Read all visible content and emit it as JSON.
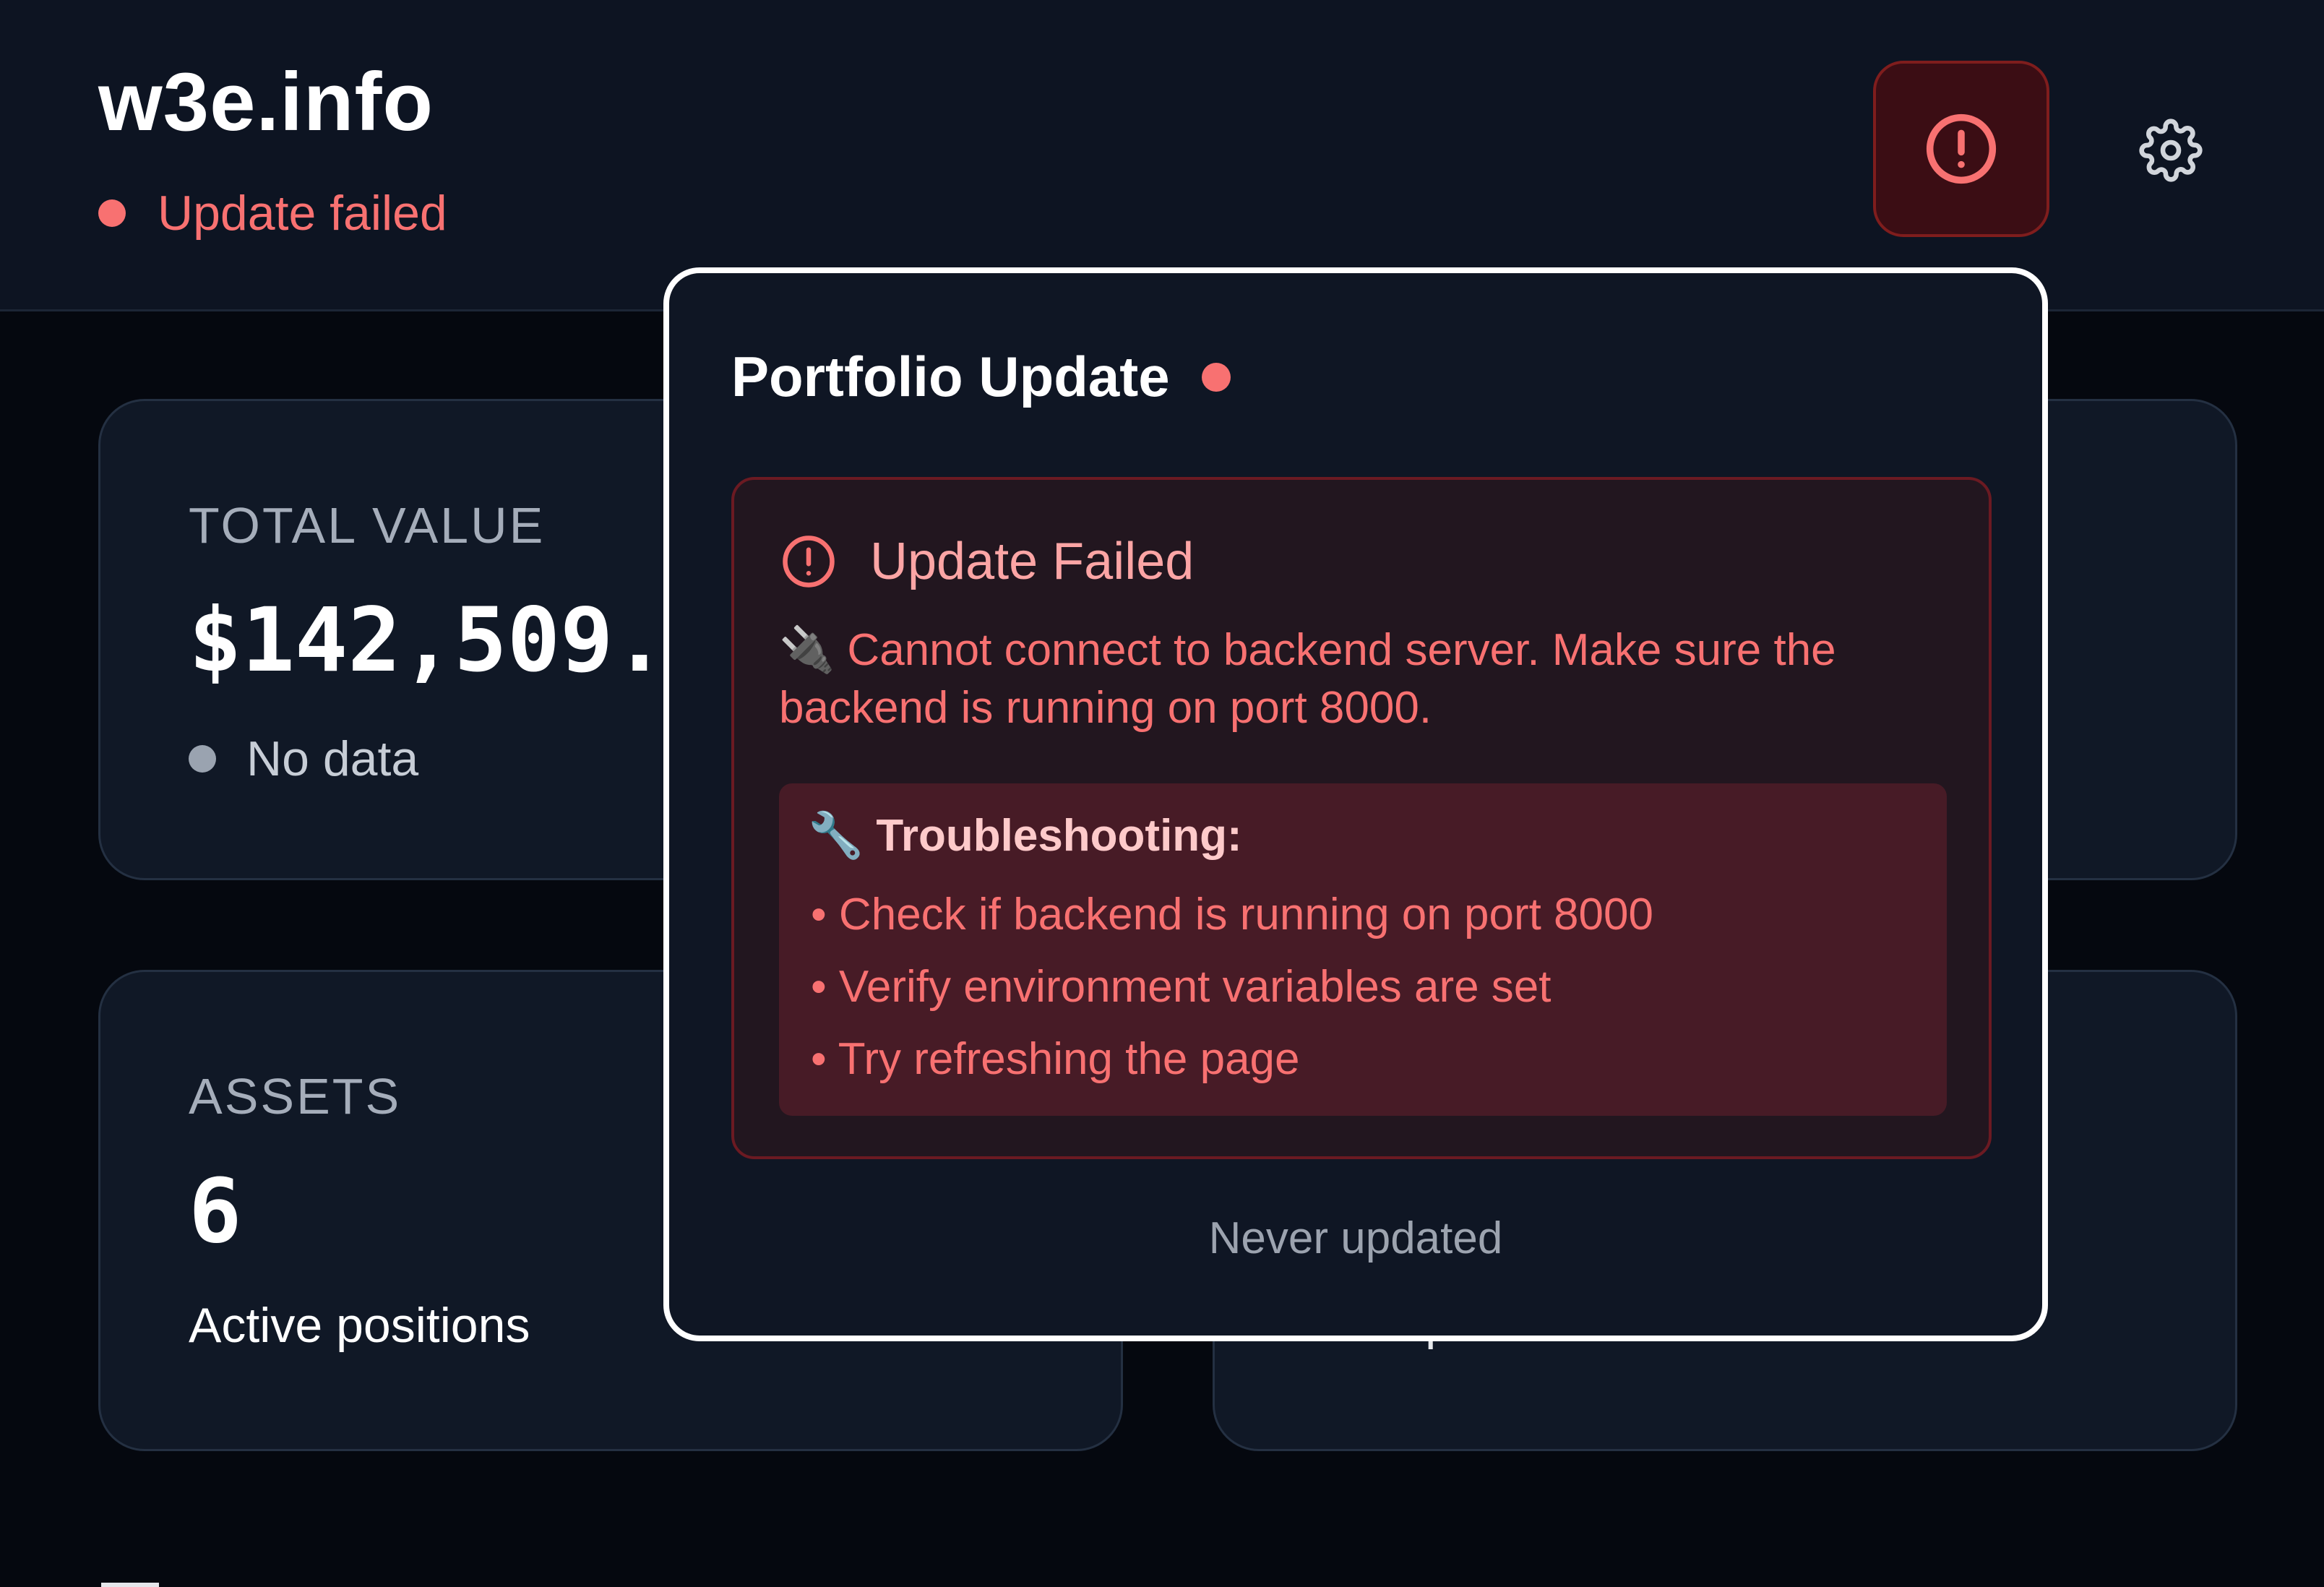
{
  "header": {
    "brand": "w3e.info",
    "status_text": "Update failed",
    "status_color": "#f87171",
    "alert_icon": "alert-circle-icon",
    "settings_icon": "gear-icon"
  },
  "cards": {
    "total_value": {
      "label": "TOTAL VALUE",
      "value": "$142,509.",
      "sub": "No data"
    },
    "assets": {
      "label": "ASSETS",
      "value": "6",
      "sub": "Active positions"
    },
    "right_bottom": {
      "sub_partial": "... of portfolio"
    }
  },
  "popup": {
    "title": "Portfolio Update",
    "error": {
      "title": "Update Failed",
      "icon": "alert-circle-icon",
      "message": "🔌 Cannot connect to backend server. Make sure the backend is running on port 8000."
    },
    "troubleshooting": {
      "title": "🔧 Troubleshooting:",
      "items": [
        "• Check if backend is running on port 8000",
        "• Verify environment variables are set",
        "• Try refreshing the page"
      ]
    },
    "footer": "Never updated"
  },
  "colors": {
    "background": "#05080f",
    "panel": "#101826",
    "error_accent": "#f87171",
    "error_box": "#22161f",
    "trouble_box": "#471b26"
  }
}
